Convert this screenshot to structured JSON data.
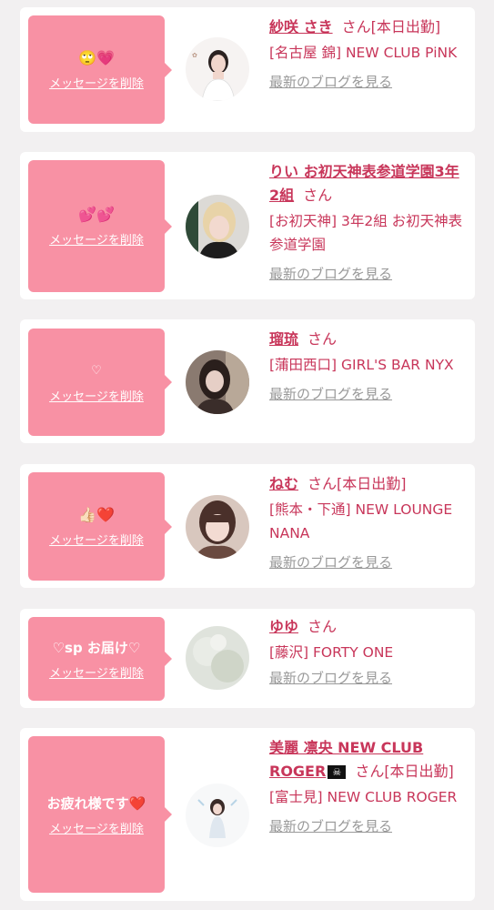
{
  "delete_label": "メッセージを削除",
  "blog_label": "最新のブログを見る",
  "san": "さん",
  "items": [
    {
      "message": "🙄💗",
      "name": "紗咲 さき",
      "suffix": "さん[本日出勤]",
      "shop": "[名古屋 錦] NEW CLUB PiNK",
      "avatar": "woman-white-top-avatar"
    },
    {
      "message": "💕💕",
      "name": "りい お初天神表参道学園3年2組",
      "suffix": "さん",
      "shop": "[お初天神] 3年2組 お初天神表参道学園",
      "avatar": "blonde-woman-avatar"
    },
    {
      "message": "♡",
      "name": "瑠琉",
      "suffix": "さん",
      "shop": "[蒲田西口] GIRL'S BAR NYX",
      "avatar": "woman-dark-hair-avatar"
    },
    {
      "message": "👍🏻❤️",
      "name": "ねむ",
      "suffix": "さん[本日出勤]",
      "shop": "[熊本・下通] NEW LOUNGE NANA",
      "avatar": "woman-bangs-avatar"
    },
    {
      "message": "♡sp お届け♡",
      "name": "ゆゆ",
      "suffix": "さん",
      "shop": "[藤沢] FORTY ONE",
      "avatar": "blurred-photo-avatar"
    },
    {
      "message": "お疲れ様です❤️",
      "name": "美麗 凛央 NEW CLUB ROGER",
      "flag": "☠",
      "suffix": "さん[本日出勤]",
      "shop": "[富士見] NEW CLUB ROGER",
      "avatar": "woman-standing-avatar"
    }
  ]
}
